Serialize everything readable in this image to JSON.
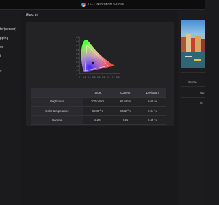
{
  "window": {
    "title": "LG Calibration Studio"
  },
  "sidebar": {
    "items": [
      {
        "label": "ter(sensor)"
      },
      {
        "label": "pping"
      },
      {
        "label": "ce"
      },
      {
        "label": "t"
      },
      {
        "label": "s"
      }
    ]
  },
  "main": {
    "result_label": "Result",
    "chart": {
      "ticks_x": [
        "0",
        "0.1",
        "0.2",
        "0.3",
        "0.4",
        "0.5",
        "0.6",
        "0.7",
        "0.8"
      ],
      "ticks_y": [
        "0.9",
        "0.8",
        "0.7",
        "0.6",
        "0.5",
        "0.4",
        "0.3",
        "0.2",
        "0.1",
        "0"
      ]
    },
    "table": {
      "headers": [
        "",
        "Target",
        "Current",
        "Deviation"
      ],
      "rows": [
        {
          "name": "Brightness",
          "target": "100 cd/m²",
          "current": "99 cd/m²",
          "deviation": "0.00 %"
        },
        {
          "name": "Color temperature",
          "target": "6500 °K",
          "current": "6522 °K",
          "deviation": "0.34 %"
        },
        {
          "name": "Gamma",
          "target": "2.20",
          "current": "2.21",
          "deviation": "0.45 %"
        }
      ]
    }
  },
  "right_panel": {
    "buttons": [
      {
        "label": "Before"
      },
      {
        "label": "Vel"
      },
      {
        "label": "Gr"
      }
    ]
  }
}
